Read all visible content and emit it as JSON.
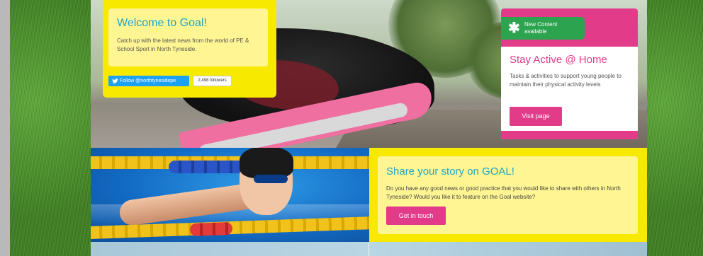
{
  "welcome": {
    "title": "Welcome to Goal!",
    "text": "Catch up with the latest news from the world of PE & School Sport in North Tyneside.",
    "twitter_button": "Follow @northtynesidepe",
    "followers": "2,498 followers",
    "twitter_icon": "twitter-bird-icon"
  },
  "stay_active": {
    "badge": "New Content available",
    "badge_icon": "asterisk-icon",
    "title": "Stay Active @ Home",
    "text": "Tasks & activities to support young people to maintain their physical activity levels",
    "button": "Visit page"
  },
  "share": {
    "title": "Share your story on GOAL!",
    "text": "Do you have any good news or good practice that you would like to share with others in North Tyneside? Would you like it to feature on the Goal website?",
    "button": "Get in touch"
  },
  "colors": {
    "yellow": "#f7e900",
    "light_yellow": "#fff593",
    "pink": "#e23b8a",
    "green": "#2ca44f",
    "title_blue": "#1ea6c9",
    "twitter_blue": "#1da1f2"
  },
  "images": {
    "hero": "running-shoe-photo",
    "swim": "swimmer-photo",
    "background": "grass-texture"
  }
}
